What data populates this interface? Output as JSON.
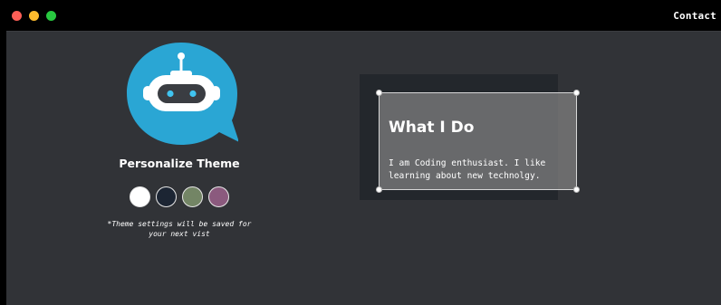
{
  "nav": {
    "contact_label": "Contact"
  },
  "theme": {
    "title": "Personalize Theme",
    "note_line1": "*Theme settings will be saved for",
    "note_line2": "your next vist",
    "swatches": [
      {
        "name": "white",
        "color": "#ffffff"
      },
      {
        "name": "navy",
        "color": "#1c2533"
      },
      {
        "name": "sage",
        "color": "#738565"
      },
      {
        "name": "plum",
        "color": "#8b5a7e"
      }
    ]
  },
  "about": {
    "heading": "What I Do",
    "line1": "I am Coding enthusiast. I like",
    "line2": "learning about new technolgy."
  },
  "colors": {
    "background": "#313337",
    "titlebar": "#000000",
    "logo_blue": "#2aa6d4",
    "bot_eyes": "#40c4f0"
  },
  "icons": {
    "logo": "robot-chat-bubble-icon"
  }
}
